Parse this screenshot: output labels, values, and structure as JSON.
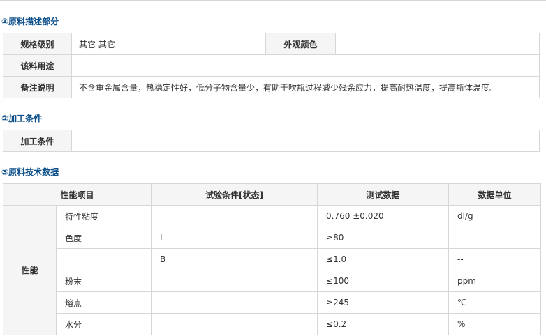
{
  "section1": {
    "title": "①原料描述部分",
    "spec_label": "规格级别",
    "spec_value": "其它 其它",
    "appearance_label": "外观颜色",
    "appearance_value": "",
    "usage_label": "该料用途",
    "usage_value": "",
    "remark_label": "备注说明",
    "remark_value": "不含重金属含量，热稳定性好，低分子物含量少，有助于吹瓶过程减少残余应力，提高耐热温度，提高瓶体温度。"
  },
  "section2": {
    "title": "②加工条件",
    "label": "加工条件",
    "value": ""
  },
  "section3": {
    "title": "③原料技术数据",
    "headers": {
      "property": "性能项目",
      "condition": "试验条件[状态]",
      "data": "测试数据",
      "unit": "数据单位"
    },
    "group": "性能",
    "rows": [
      {
        "name": "特性粘度",
        "condition": "",
        "value": "0.760 ±0.020",
        "unit": "dl/g"
      },
      {
        "name": "色度",
        "condition": "L",
        "value": "≥80",
        "unit": "--"
      },
      {
        "name": "",
        "condition": "B",
        "value": "≤1.0",
        "unit": "--"
      },
      {
        "name": "粉末",
        "condition": "",
        "value": "≤100",
        "unit": "ppm"
      },
      {
        "name": "熔点",
        "condition": "",
        "value": "≥245",
        "unit": "℃"
      },
      {
        "name": "水分",
        "condition": "",
        "value": "≤0.2",
        "unit": "%"
      }
    ]
  }
}
